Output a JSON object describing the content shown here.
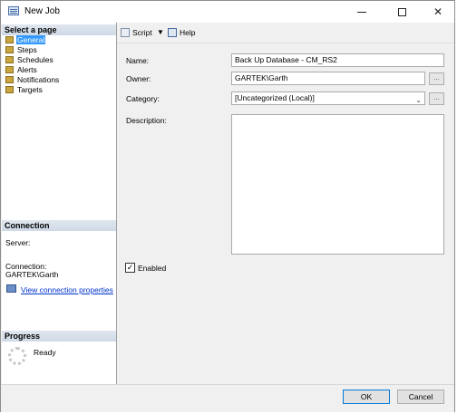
{
  "window": {
    "title": "New Job"
  },
  "left_panel": {
    "select_page_header": "Select a page",
    "pages": [
      {
        "label": "General",
        "selected": true
      },
      {
        "label": "Steps"
      },
      {
        "label": "Schedules"
      },
      {
        "label": "Alerts"
      },
      {
        "label": "Notifications"
      },
      {
        "label": "Targets"
      }
    ],
    "connection_header": "Connection",
    "server_label": "Server:",
    "connection_label": "Connection:",
    "connection_value": "GARTEK\\Garth",
    "view_connection_link": "View connection properties",
    "progress_header": "Progress",
    "progress_status": "Ready"
  },
  "toolbar": {
    "script_label": "Script",
    "help_label": "Help"
  },
  "form": {
    "name_label": "Name:",
    "name_value": "Back Up Database - CM_RS2",
    "owner_label": "Owner:",
    "owner_value": "GARTEK\\Garth",
    "browse_label": "...",
    "category_label": "Category:",
    "category_value": "[Uncategorized (Local)]",
    "description_label": "Description:",
    "description_value": "",
    "enabled_label": "Enabled",
    "enabled_checked": true
  },
  "buttons": {
    "ok_label": "OK",
    "cancel_label": "Cancel"
  },
  "icons": {
    "app": "job-icon",
    "page": "page-icon",
    "script": "script-icon",
    "help": "help-icon",
    "connection": "connection-properties-icon",
    "progress": "spinner-icon"
  }
}
